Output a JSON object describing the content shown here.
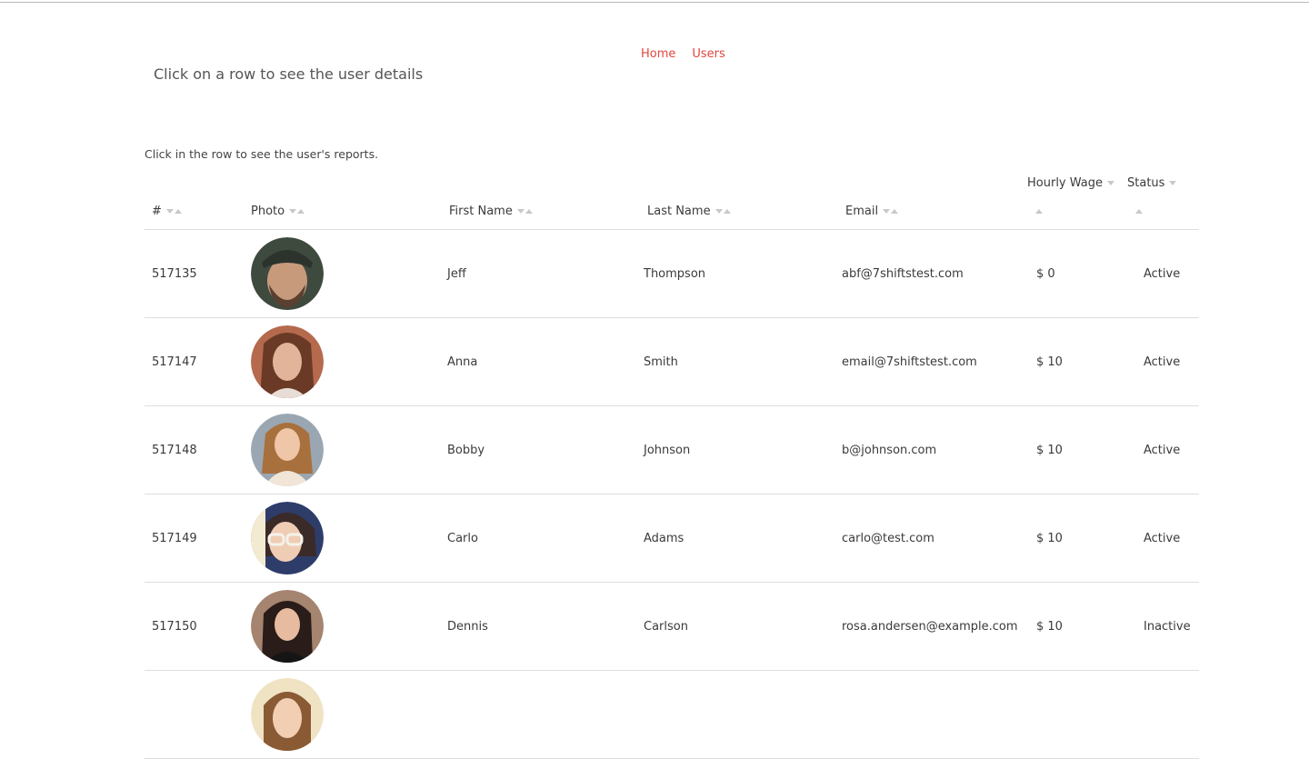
{
  "nav": {
    "home": "Home",
    "users": "Users"
  },
  "heading": "Click on a row to see the user details",
  "subnote": "Click in the row to see the user's reports.",
  "columns": {
    "id": "#",
    "photo": "Photo",
    "first_name": "First Name",
    "last_name": "Last Name",
    "email": "Email",
    "wage": "Hourly Wage",
    "status": "Status"
  },
  "colors": {
    "accent": "#e2473d",
    "text": "#3a3a3a",
    "divider": "#dedede"
  },
  "rows": [
    {
      "id": "517135",
      "first": "Jeff",
      "last": "Thompson",
      "email": "abf@7shiftstest.com",
      "wage": "$ 0",
      "status": "Active"
    },
    {
      "id": "517147",
      "first": "Anna",
      "last": "Smith",
      "email": "email@7shiftstest.com",
      "wage": "$ 10",
      "status": "Active"
    },
    {
      "id": "517148",
      "first": "Bobby",
      "last": "Johnson",
      "email": "b@johnson.com",
      "wage": "$ 10",
      "status": "Active"
    },
    {
      "id": "517149",
      "first": "Carlo",
      "last": "Adams",
      "email": "carlo@test.com",
      "wage": "$ 10",
      "status": "Active"
    },
    {
      "id": "517150",
      "first": "Dennis",
      "last": "Carlson",
      "email": "rosa.andersen@example.com",
      "wage": "$ 10",
      "status": "Inactive"
    }
  ]
}
